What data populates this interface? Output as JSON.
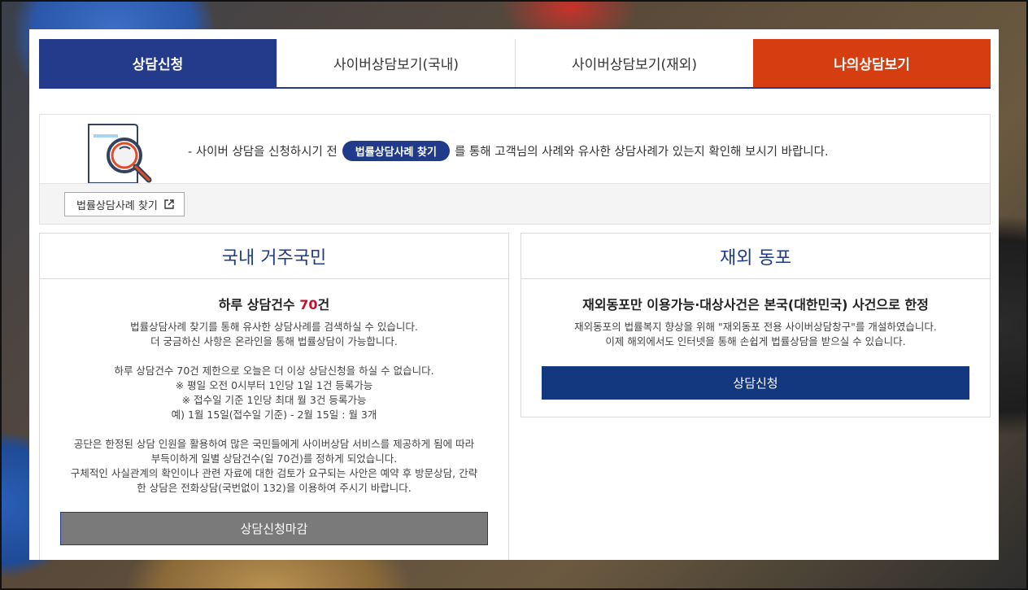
{
  "tabs": [
    {
      "label": "상담신청"
    },
    {
      "label": "사이버상담보기(국내)"
    },
    {
      "label": "사이버상담보기(재외)"
    },
    {
      "label": "나의상담보기"
    }
  ],
  "info": {
    "text_before": "- 사이버 상담을 신청하시기 전",
    "pill_label": "법률상담사례 찾기",
    "text_after": "를 통해 고객님의 사례와 유사한 상담사례가 있는지 확인해 보시기 바랍니다.",
    "find_button": "법률상담사례 찾기"
  },
  "domestic": {
    "title": "국내 거주국민",
    "sub_prefix": "하루 상담건수 ",
    "sub_num": "70",
    "sub_suffix": "건",
    "p1": "법률상담사례 찾기를 통해 유사한 상담사례를 검색하실 수 있습니다.",
    "p2": "더 궁금하신 사항은 온라인을 통해 법률상담이 가능합니다.",
    "p3": "하루 상담건수 70건 제한으로 오늘은 더 이상 상담신청을 하실 수 없습니다.",
    "p4": "※ 평일 오전 0시부터 1인당 1일 1건 등록가능",
    "p5": "※ 접수일 기준 1인당 최대 월 3건 등록가능",
    "p6": "예) 1월 15일(접수일 기준) - 2월 15일 : 월 3개",
    "p7": "공단은 한정된 상담 인원을 활용하여 많은 국민들에게 사이버상담 서비스를 제공하게 됨에 따라",
    "p8": "부득이하게 일별 상담건수(일 70건)를 정하게 되었습니다.",
    "p9": "구체적인 사실관계의 확인이나 관련 자료에 대한 검토가 요구되는 사안은 예약 후 방문상담, 간략",
    "p10": "한 상담은 전화상담(국번없이 132)을 이용하여 주시기 바랍니다.",
    "button": "상담신청마감"
  },
  "overseas": {
    "title": "재외 동포",
    "sub": "재외동포만 이용가능·대상사건은 본국(대한민국) 사건으로 한정",
    "p1": "재외동포의 법률복지 향상을 위해 \"재외동포 전용 사이버상담창구\"를 개설하였습니다.",
    "p2": "이제 해외에서도 인터넷을 통해 손쉽게 법률상담을 받으실 수 있습니다.",
    "button": "상담신청"
  },
  "colors": {
    "navy": "#243b8c",
    "orange": "#d63e12",
    "red_number": "#c8102e",
    "closed_gray": "#7a7a7a"
  },
  "icons": [
    "document-search-icon",
    "external-link-icon"
  ]
}
